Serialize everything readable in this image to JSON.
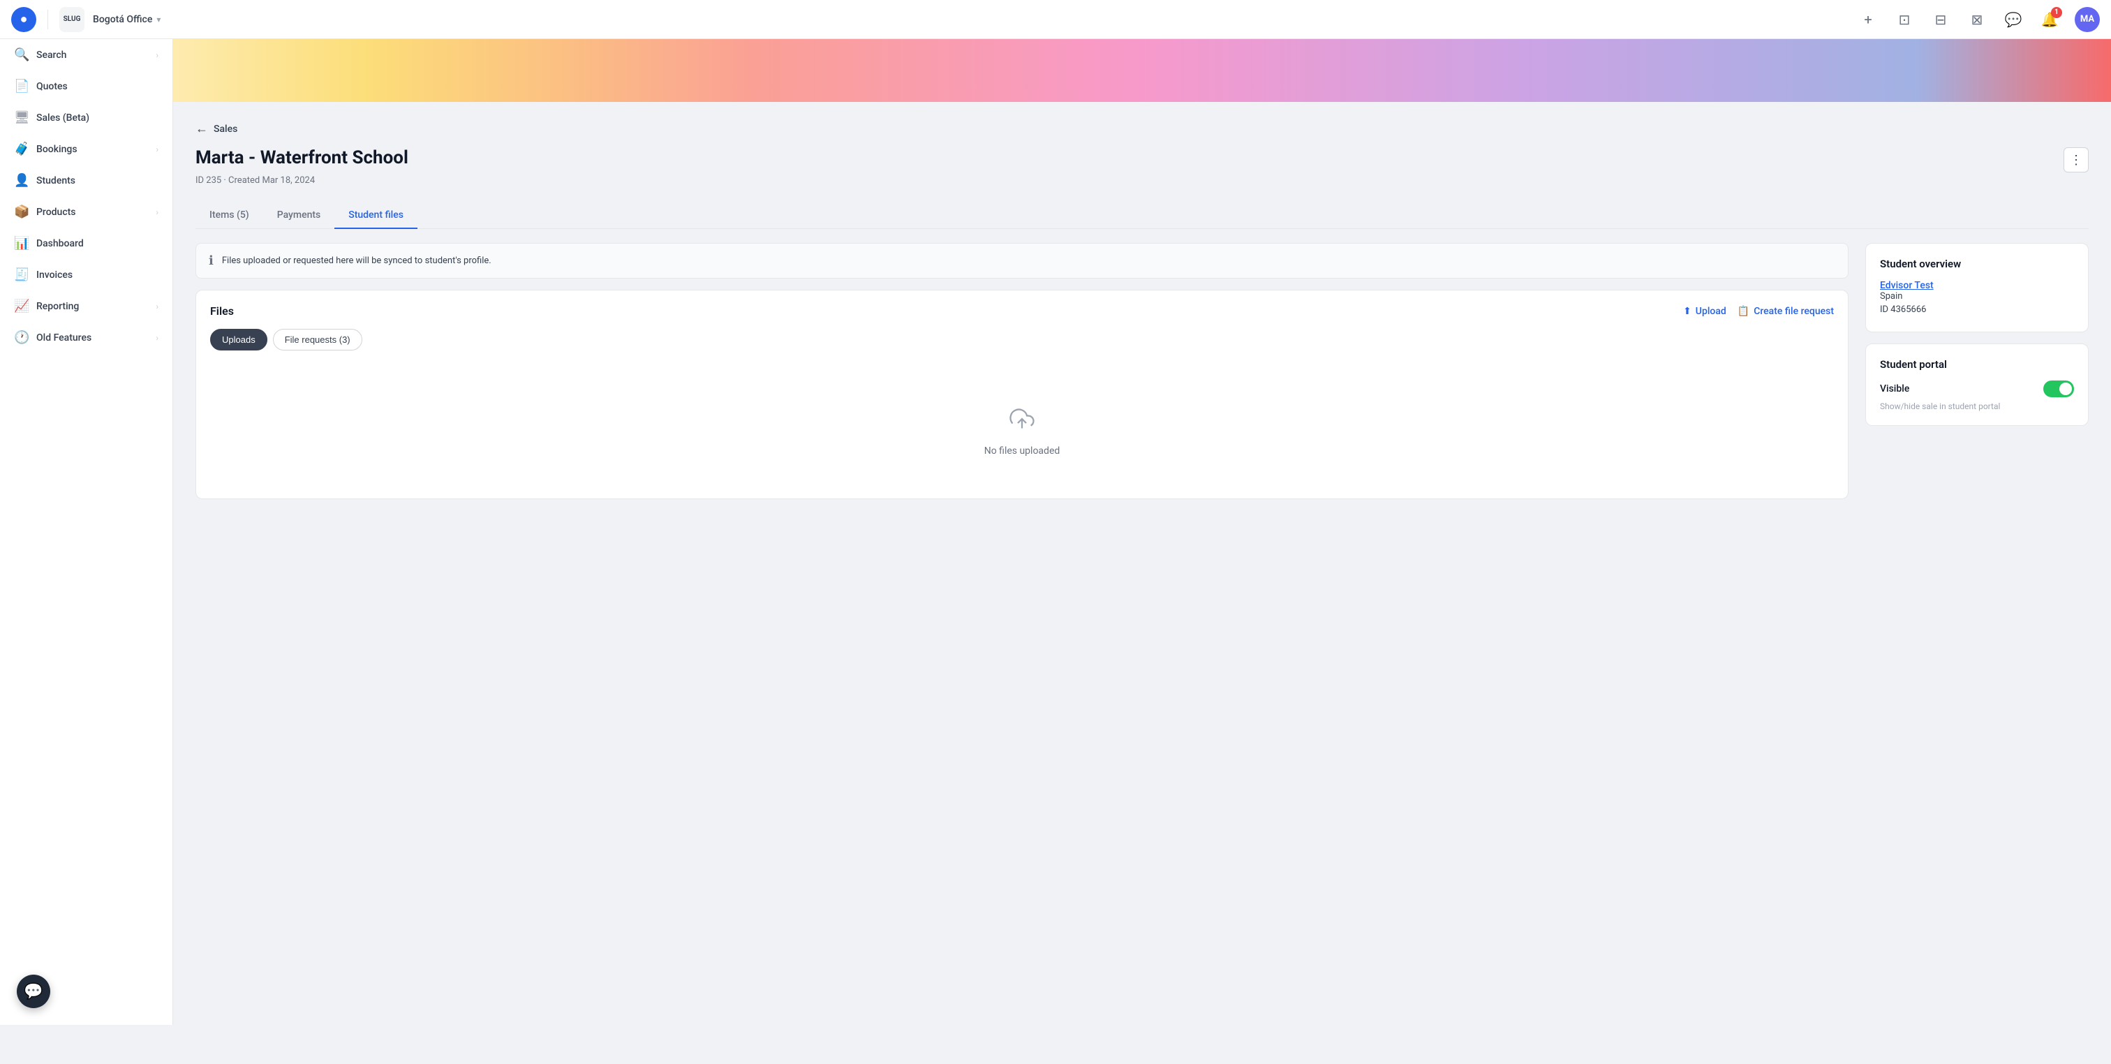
{
  "navbar": {
    "logo_text": "●",
    "brand_text": "SLUG",
    "office_label": "Bogotá Office",
    "chevron": "▾",
    "add_icon": "+",
    "inbox_icon": "⊡",
    "calendar_icon": "⊟",
    "clipboard_icon": "⊠",
    "chat_icon": "💬",
    "bell_icon": "🔔",
    "notification_count": "1",
    "avatar_initials": "MA"
  },
  "sidebar": {
    "items": [
      {
        "id": "search",
        "label": "Search",
        "icon": "🔍",
        "has_chevron": true
      },
      {
        "id": "quotes",
        "label": "Quotes",
        "icon": "📄",
        "has_chevron": false
      },
      {
        "id": "sales-beta",
        "label": "Sales (Beta)",
        "icon": "🖥",
        "has_chevron": false
      },
      {
        "id": "bookings",
        "label": "Bookings",
        "icon": "🧳",
        "has_chevron": true
      },
      {
        "id": "students",
        "label": "Students",
        "icon": "👤",
        "has_chevron": false
      },
      {
        "id": "products",
        "label": "Products",
        "icon": "📦",
        "has_chevron": true
      },
      {
        "id": "dashboard",
        "label": "Dashboard",
        "icon": "📊",
        "has_chevron": false
      },
      {
        "id": "invoices",
        "label": "Invoices",
        "icon": "🧾",
        "has_chevron": false
      },
      {
        "id": "reporting",
        "label": "Reporting",
        "icon": "📈",
        "has_chevron": true
      },
      {
        "id": "old-features",
        "label": "Old Features",
        "icon": "🕐",
        "has_chevron": true
      }
    ]
  },
  "breadcrumb": {
    "back_arrow": "←",
    "label": "Sales"
  },
  "page": {
    "title": "Marta - Waterfront School",
    "meta": "ID 235 · Created Mar 18, 2024",
    "more_icon": "⋮"
  },
  "tabs": [
    {
      "id": "items",
      "label": "Items (5)",
      "active": false
    },
    {
      "id": "payments",
      "label": "Payments",
      "active": false
    },
    {
      "id": "student-files",
      "label": "Student files",
      "active": true
    }
  ],
  "info_banner": {
    "icon": "ℹ",
    "text": "Files uploaded or requested here will be synced to student's profile."
  },
  "files_section": {
    "title": "Files",
    "upload_label": "Upload",
    "create_request_label": "Create file request",
    "upload_icon": "⬆",
    "create_icon": "📋",
    "file_tabs": [
      {
        "id": "uploads",
        "label": "Uploads",
        "active": true
      },
      {
        "id": "file-requests",
        "label": "File requests (3)",
        "active": false
      }
    ],
    "empty_icon": "⬆",
    "empty_text": "No files uploaded"
  },
  "student_overview": {
    "title": "Student overview",
    "student_name": "Edvisor Test",
    "country": "Spain",
    "id_label": "ID 4365666"
  },
  "student_portal": {
    "title": "Student portal",
    "visible_label": "Visible",
    "visible_on": true,
    "description": "Show/hide sale in student portal"
  },
  "chat": {
    "icon": "💬"
  }
}
